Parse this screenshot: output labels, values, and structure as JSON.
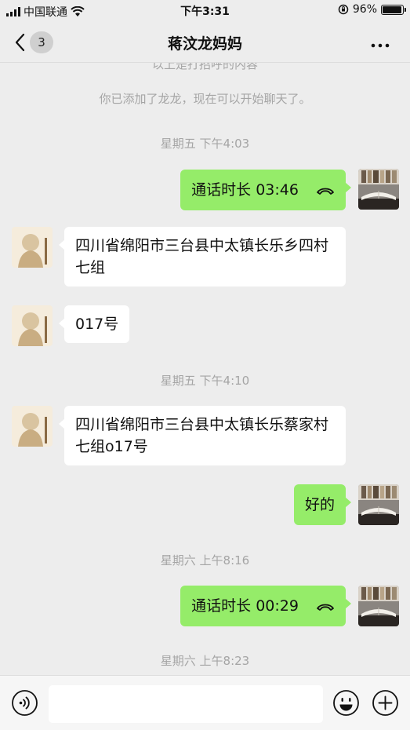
{
  "status_bar": {
    "carrier": "中国联通",
    "time": "下午3:31",
    "battery": "96%",
    "battery_level": 0.96
  },
  "nav": {
    "unread_count": "3",
    "title": "蒋汶龙妈妈"
  },
  "chat": {
    "system_partial": "以上是打招呼的内容",
    "system_added": "你已添加了龙龙，现在可以开始聊天了。",
    "times": [
      "星期五 下午4:03",
      "星期五 下午4:10",
      "星期六 上午8:16",
      "星期六 上午8:23"
    ],
    "messages": [
      {
        "side": "right",
        "type": "call",
        "text": "通话时长 03:46"
      },
      {
        "side": "left",
        "type": "text",
        "text": "四川省绵阳市三台县中太镇长乐乡四村七组"
      },
      {
        "side": "left",
        "type": "text",
        "text": "017号"
      },
      {
        "side": "left",
        "type": "text",
        "text": "四川省绵阳市三台县中太镇长乐蔡家村七组o17号"
      },
      {
        "side": "right",
        "type": "text",
        "text": "好的"
      },
      {
        "side": "right",
        "type": "call",
        "text": "通话时长 00:29"
      }
    ]
  },
  "colors": {
    "background": "#ededed",
    "bubble_self": "#95ec69",
    "bubble_other": "#ffffff",
    "meta_text": "#a5a5a5"
  },
  "icons": {
    "back": "chevron-left-icon",
    "more": "more-dots-icon",
    "voice": "voice-input-icon",
    "emoji": "emoji-icon",
    "plus": "plus-icon",
    "call": "phone-hangup-icon",
    "wifi": "wifi-icon",
    "orientation_lock": "orientation-lock-icon"
  }
}
